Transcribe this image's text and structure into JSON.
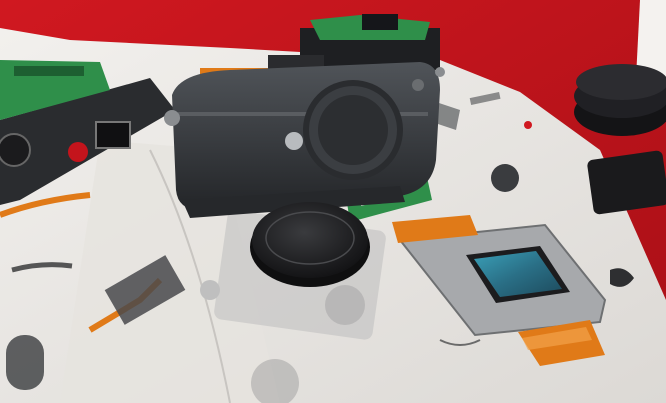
{
  "scene": {
    "colors": {
      "backdrop": "#c4141c",
      "paper": "#ece9e5",
      "camera_body": "#3a3d40",
      "pcb_green": "#2f8f4a",
      "flex_orange": "#e07a18",
      "sensor_glass": "#2c6f86",
      "cap_black": "#1c1c1e"
    },
    "objects": [
      "disassembled-rangefinder-camera-body",
      "camera-body-cap",
      "image-sensor-module",
      "circuit-board",
      "flex-ribbon-cable",
      "second-camera-top-plate",
      "lens-cap-stack",
      "exploded-view-catalog-pages"
    ]
  }
}
